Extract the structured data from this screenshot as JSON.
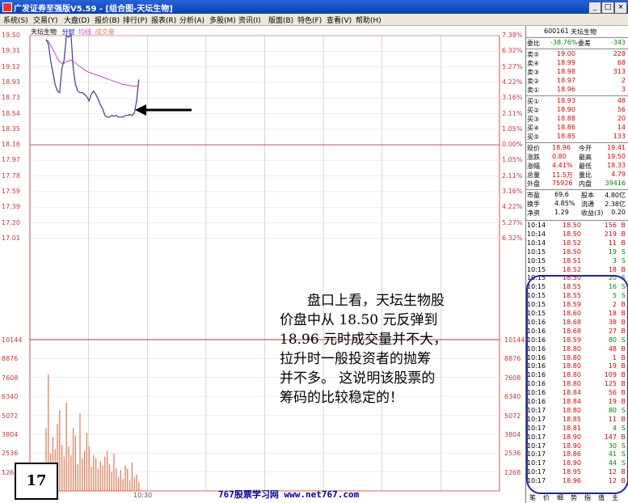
{
  "titlebar": {
    "title": "广发证券至强版V5.59 - [组合图-天坛生物]",
    "minimize": "_",
    "maximize": "□",
    "close": "×"
  },
  "menu": [
    "系统(S)",
    "交易(Y)",
    "大盘(D)",
    "报价(B)",
    "排行(P)",
    "报表(R)",
    "分析(A)",
    "多股(M)",
    "资讯(I)",
    "版面(B)",
    "特色(F)",
    "查看(V)",
    "帮助(H)"
  ],
  "chart": {
    "legend": {
      "name": "天坛生物",
      "s1": "分时",
      "s2": "均线",
      "s3": "成交量"
    },
    "price_ticks": [
      "19.50",
      "19.31",
      "19.12",
      "18.93",
      "18.73",
      "18.54",
      "18.35",
      "18.16",
      "17.97",
      "17.78",
      "17.59",
      "17.39",
      "17.20",
      "17.01"
    ],
    "pct_ticks": [
      "7.38%",
      "6.32%",
      "5.27%",
      "4.22%",
      "3.16%",
      "2.11%",
      "1.05%",
      "0.00%",
      "1.05%",
      "2.11%",
      "3.16%",
      "4.22%",
      "5.27%",
      "6.32%"
    ],
    "vol_ticks": [
      "10144",
      "8876",
      "7608",
      "6340",
      "5072",
      "3804",
      "2536",
      "1268"
    ],
    "time_label": "10:30",
    "colors": {
      "price": "#4a4a8a",
      "avg": "#cc44cc",
      "volume": "#e08060",
      "grid": "#cc3333"
    }
  },
  "chart_data": {
    "type": "line",
    "title": "天坛生物",
    "ylim": [
      17.01,
      19.5
    ],
    "series": [
      {
        "name": "分时",
        "values": [
          19.45,
          19.4,
          19.2,
          19.05,
          18.9,
          18.82,
          18.8,
          19.1,
          19.2,
          19.5,
          19.48,
          19.52,
          19.1,
          18.9,
          18.82,
          18.8,
          18.8,
          18.78,
          18.75,
          18.7,
          18.78,
          18.82,
          18.78,
          18.72,
          18.65,
          18.6,
          18.52,
          18.5,
          18.5,
          18.52,
          18.51,
          18.52,
          18.5,
          18.5,
          18.5,
          18.52,
          18.52,
          18.53,
          18.52,
          18.55,
          18.7,
          18.96
        ]
      },
      {
        "name": "均线",
        "values": [
          19.45,
          19.43,
          19.38,
          19.33,
          19.28,
          19.22,
          19.18,
          19.16,
          19.16,
          19.18,
          19.19,
          19.2,
          19.18,
          19.16,
          19.14,
          19.12,
          19.1,
          19.08,
          19.06,
          19.05,
          19.04,
          19.03,
          19.02,
          19.01,
          19.0,
          18.99,
          18.98,
          18.97,
          18.96,
          18.95,
          18.94,
          18.93,
          18.92,
          18.91,
          18.9,
          18.9,
          18.89,
          18.89,
          18.88,
          18.88,
          18.88,
          18.89
        ]
      },
      {
        "name": "成交量",
        "values": [
          4200,
          7800,
          2500,
          3600,
          2800,
          4500,
          5400,
          3100,
          2300,
          5900,
          3000,
          2400,
          4200,
          3700,
          1800,
          5200,
          2200,
          2700,
          3900,
          3000,
          1600,
          2400,
          2200,
          1500,
          2000,
          1700,
          2300,
          2700,
          1800,
          1300,
          2500,
          1500,
          900,
          1400,
          800,
          1700,
          1500,
          700,
          1900,
          900,
          1100,
          600
        ]
      }
    ]
  },
  "panel": {
    "code": "600161",
    "name": "天坛生物",
    "webi_label": "委比",
    "webi": "-38.76%",
    "weicha_label": "委差",
    "weicha": "-343",
    "sell": [
      {
        "l": "卖⑤",
        "p": "19.00",
        "v": "228"
      },
      {
        "l": "卖④",
        "p": "18.99",
        "v": "68"
      },
      {
        "l": "卖③",
        "p": "18.98",
        "v": "313"
      },
      {
        "l": "卖②",
        "p": "18.97",
        "v": "2"
      },
      {
        "l": "卖①",
        "p": "18.96",
        "v": "3"
      }
    ],
    "buy": [
      {
        "l": "买①",
        "p": "18.93",
        "v": "48"
      },
      {
        "l": "买②",
        "p": "18.90",
        "v": "56"
      },
      {
        "l": "买③",
        "p": "18.88",
        "v": "20"
      },
      {
        "l": "买④",
        "p": "18.86",
        "v": "14"
      },
      {
        "l": "买⑤",
        "p": "18.85",
        "v": "133"
      }
    ],
    "stats": [
      {
        "a": "现价",
        "av": "18.96",
        "b": "今开",
        "bv": "19.41"
      },
      {
        "a": "涨跌",
        "av": "0.80",
        "b": "最高",
        "bv": "19.50"
      },
      {
        "a": "涨幅",
        "av": "4.41%",
        "b": "最低",
        "bv": "18.33"
      },
      {
        "a": "总量",
        "av": "11.5万",
        "b": "量比",
        "bv": "4.79"
      },
      {
        "a": "外盘",
        "av": "75926",
        "b": "内盘",
        "bv": "39416"
      }
    ],
    "stats2": [
      {
        "a": "市盈",
        "av": "69.6",
        "b": "股本",
        "bv": "4.80亿"
      },
      {
        "a": "换手",
        "av": "4.85%",
        "b": "流通",
        "bv": "2.38亿"
      },
      {
        "a": "净资",
        "av": "1.29",
        "b": "收益(3)",
        "bv": "0.20"
      }
    ],
    "ticks": [
      {
        "t": "10:14",
        "p": "18.50",
        "v": "156",
        "d": "B"
      },
      {
        "t": "10:14",
        "p": "18.50",
        "v": "219",
        "d": "B"
      },
      {
        "t": "10:14",
        "p": "18.52",
        "v": "11",
        "d": "B"
      },
      {
        "t": "10:15",
        "p": "18.50",
        "v": "19",
        "d": "S"
      },
      {
        "t": "10:15",
        "p": "18.51",
        "v": "3",
        "d": "S"
      },
      {
        "t": "10:15",
        "p": "18.52",
        "v": "18",
        "d": "B"
      },
      {
        "t": "10:15",
        "p": "18.50",
        "v": "20",
        "d": "S"
      },
      {
        "t": "10:15",
        "p": "18.55",
        "v": "16",
        "d": "S"
      },
      {
        "t": "10:15",
        "p": "18.55",
        "v": "5",
        "d": "S"
      },
      {
        "t": "10:15",
        "p": "18.59",
        "v": "2",
        "d": "B"
      },
      {
        "t": "10:15",
        "p": "18.60",
        "v": "18",
        "d": "B"
      },
      {
        "t": "10:16",
        "p": "18.68",
        "v": "38",
        "d": "B"
      },
      {
        "t": "10:16",
        "p": "18.68",
        "v": "27",
        "d": "B"
      },
      {
        "t": "10:16",
        "p": "18.59",
        "v": "80",
        "d": "S"
      },
      {
        "t": "10:16",
        "p": "18.80",
        "v": "48",
        "d": "B"
      },
      {
        "t": "10:16",
        "p": "18.80",
        "v": "1",
        "d": "B"
      },
      {
        "t": "10:16",
        "p": "18.80",
        "v": "19",
        "d": "B"
      },
      {
        "t": "10:16",
        "p": "18.80",
        "v": "109",
        "d": "B"
      },
      {
        "t": "10:16",
        "p": "18.80",
        "v": "125",
        "d": "B"
      },
      {
        "t": "10:16",
        "p": "18.84",
        "v": "56",
        "d": "B"
      },
      {
        "t": "10:16",
        "p": "18.84",
        "v": "19",
        "d": "B"
      },
      {
        "t": "10:17",
        "p": "18.80",
        "v": "80",
        "d": "S"
      },
      {
        "t": "10:17",
        "p": "18.85",
        "v": "11",
        "d": "B"
      },
      {
        "t": "10:17",
        "p": "18.81",
        "v": "4",
        "d": "S"
      },
      {
        "t": "10:17",
        "p": "18.90",
        "v": "147",
        "d": "B"
      },
      {
        "t": "10:17",
        "p": "18.90",
        "v": "30",
        "d": "S"
      },
      {
        "t": "10:17",
        "p": "18.86",
        "v": "41",
        "d": "S"
      },
      {
        "t": "10:17",
        "p": "18.90",
        "v": "44",
        "d": "S"
      },
      {
        "t": "10:17",
        "p": "18.95",
        "v": "12",
        "d": "B"
      },
      {
        "t": "10:17",
        "p": "18.96",
        "v": "12",
        "d": "B"
      }
    ],
    "bottom_tabs": [
      "笔",
      "价",
      "细",
      "势",
      "指",
      "值",
      "主"
    ]
  },
  "annotation": {
    "lines": [
      "盘口上看，天坛生物股",
      "价盘中从 18.50 元反弹到",
      "18.96 元时成交量并不大，",
      "拉升时一般投资者的抛筹",
      "并不多。 这说明该股票的",
      "筹码的比较稳定的！"
    ],
    "page_number": "17",
    "footer": "767股票学习网 www.net767.com"
  }
}
